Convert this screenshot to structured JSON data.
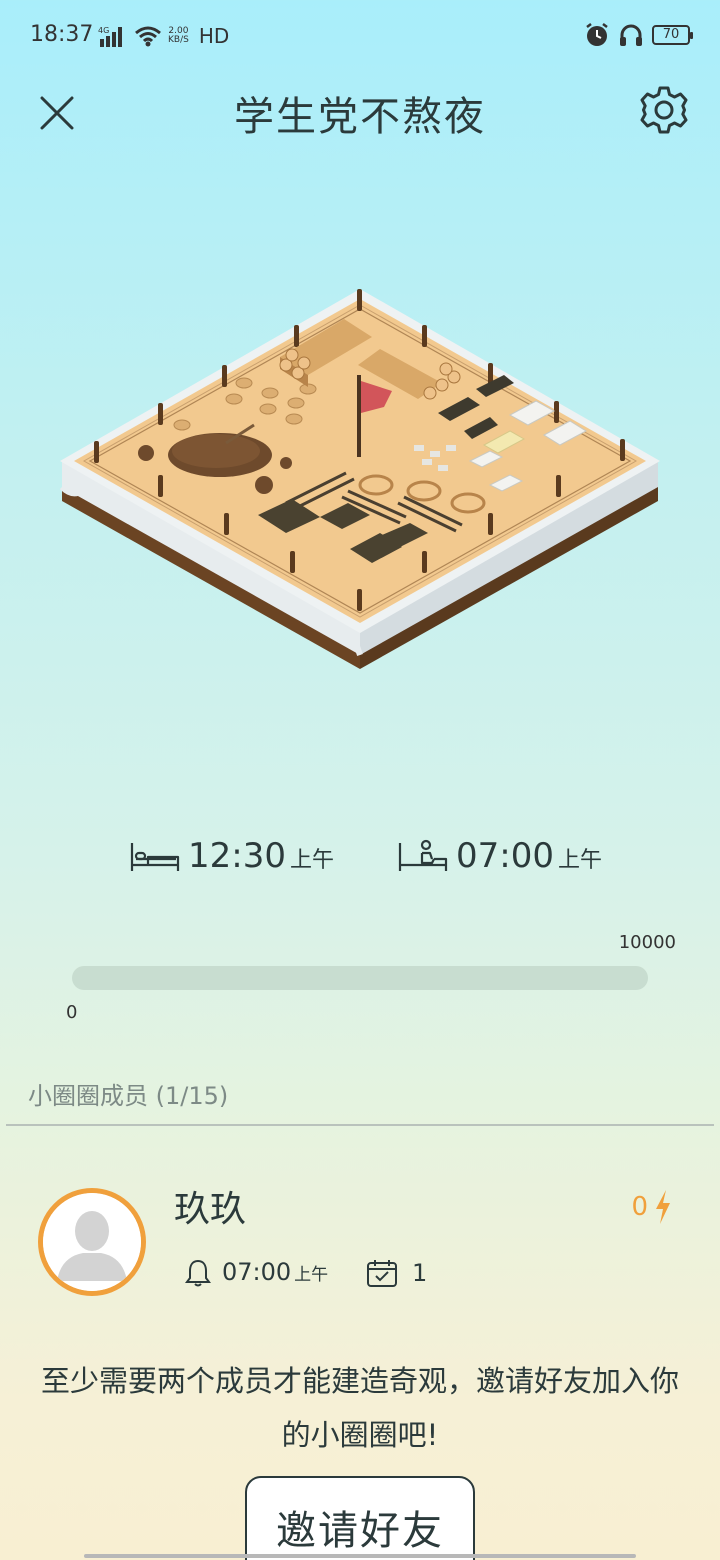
{
  "status_bar": {
    "time": "18:37",
    "signal": "4G",
    "net_speed_value": "2.00",
    "net_speed_unit": "KB/S",
    "hd_label": "HD",
    "battery": "70"
  },
  "header": {
    "title": "学生党不熬夜",
    "close_icon": "close-icon",
    "settings_icon": "gear-icon"
  },
  "schedule": {
    "sleep_time": "12:30",
    "sleep_ampm": "上午",
    "wake_time": "07:00",
    "wake_ampm": "上午"
  },
  "progress": {
    "max_label": "10000",
    "min_label": "0",
    "value_fraction": 0
  },
  "members": {
    "title": "小圈圈成员 (1/15)",
    "list": [
      {
        "name": "玖玖",
        "points": "0",
        "alarm_time": "07:00",
        "alarm_ampm": "上午",
        "days": "1"
      }
    ]
  },
  "invite": {
    "message": "至少需要两个成员才能建造奇观，邀请好友加入你的小圈圈吧!",
    "button_label": "邀请好友"
  },
  "colors": {
    "accent": "#f0a03c",
    "text": "#2b3a3b",
    "muted": "#7d8a86",
    "track": "#c8ddd0"
  }
}
